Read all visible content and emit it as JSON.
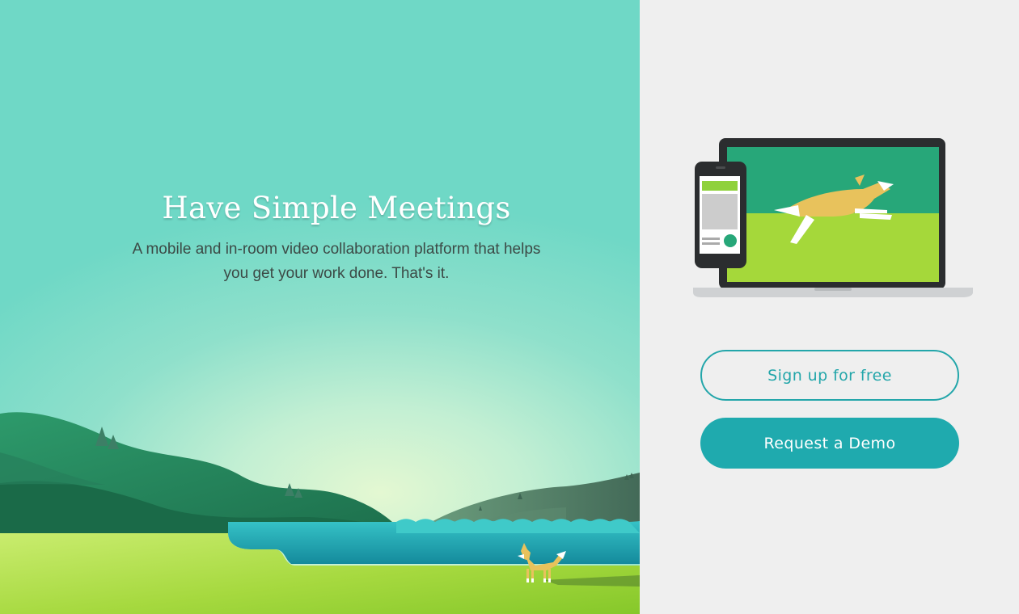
{
  "hero": {
    "title": "Have Simple Meetings",
    "subtitle": "A mobile and in-room video collaboration platform that helps you get your work done. That's it."
  },
  "actions": {
    "signup_label": "Sign up for free",
    "demo_label": "Request a Demo"
  },
  "colors": {
    "accent": "#1faaae",
    "sky": "#6fd8c6",
    "grass": "#a5d83a",
    "hill": "#1f7d57",
    "water": "#1aa3b3"
  },
  "icons": {
    "illustration": "fox-landscape",
    "devices": "phone-and-laptop-fox"
  }
}
